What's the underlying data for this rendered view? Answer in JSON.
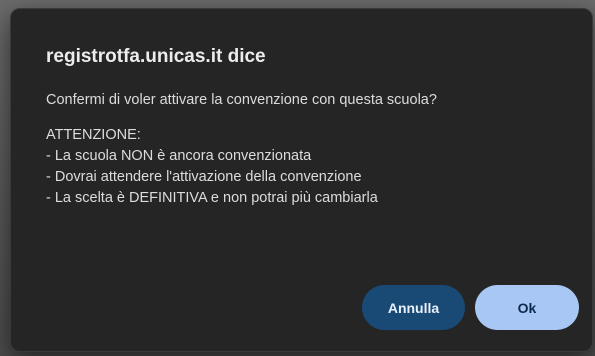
{
  "dialog": {
    "title": "registrotfa.unicas.it dice",
    "message": {
      "question": "Confermi di voler attivare la convenzione con questa scuola?",
      "warning_heading": "ATTENZIONE:",
      "warnings": [
        "- La scuola NON è ancora convenzionata",
        "- Dovrai attendere l'attivazione della convenzione",
        "- La scelta è DEFINITIVA e non potrai più cambiarla"
      ]
    },
    "buttons": {
      "cancel_label": "Annulla",
      "ok_label": "Ok"
    }
  },
  "colors": {
    "dialog_background": "#252525",
    "cancel_button": "#184a75",
    "ok_button": "#a8c7f4"
  }
}
